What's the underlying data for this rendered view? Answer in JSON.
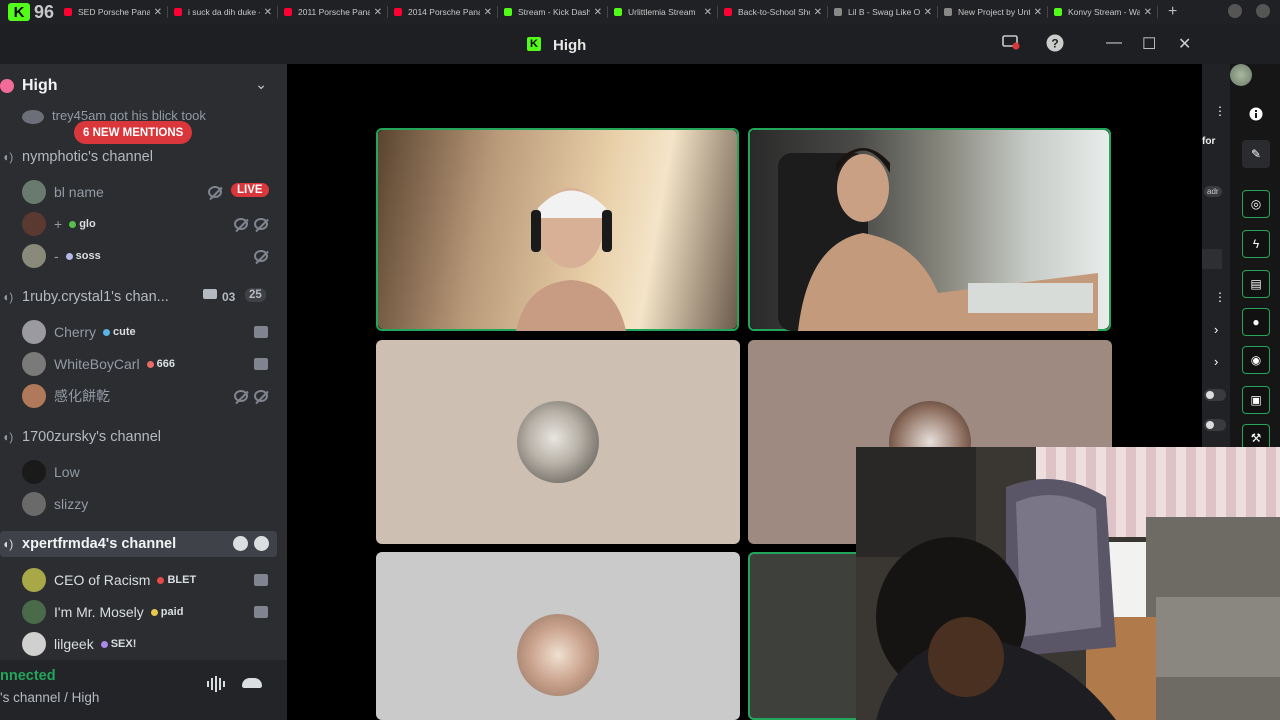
{
  "browser": {
    "tab_count": "96",
    "tabs": [
      {
        "label": "SED Porsche Panam",
        "kind": "yt"
      },
      {
        "label": "i suck da dih duke -",
        "kind": "yt"
      },
      {
        "label": "2011 Porsche Panam",
        "kind": "yt"
      },
      {
        "label": "2014 Porsche Panam",
        "kind": "yt"
      },
      {
        "label": "Stream - Kick Dashb",
        "kind": "kick"
      },
      {
        "label": "Urlittlemia Stream",
        "kind": "kick"
      },
      {
        "label": "Back-to-School Sho",
        "kind": "yt"
      },
      {
        "label": "Lil B - Swag Like Oh",
        "kind": "gen"
      },
      {
        "label": "New Project by Unt",
        "kind": "gen"
      },
      {
        "label": "Konvy Stream - Wa",
        "kind": "kick"
      }
    ]
  },
  "window": {
    "title": "High"
  },
  "sidebar": {
    "server_name": "High",
    "partial_user": "trey45am got his blick took",
    "mentions_badge": "6 NEW MENTIONS",
    "channels": [
      {
        "name": "nymphotic's channel",
        "members": [
          {
            "name": "bl name",
            "tag": "",
            "badge": "LIVE"
          },
          {
            "name": "+",
            "tag": "glo"
          },
          {
            "name": "-",
            "tag": "soss"
          }
        ]
      },
      {
        "name": "1ruby.crystal1's chan...",
        "count_video": "03",
        "count_users": "25",
        "members": [
          {
            "name": "Cherry",
            "tag": "cute"
          },
          {
            "name": "WhiteBoyCarl",
            "tag": "666"
          },
          {
            "name": "感化餅乾",
            "tag": ""
          }
        ]
      },
      {
        "name": "1700zursky's channel",
        "members": [
          {
            "name": "Low",
            "tag": ""
          },
          {
            "name": "slizzy",
            "tag": ""
          }
        ]
      },
      {
        "name": "xpertfrmda4's channel",
        "members": [
          {
            "name": "CEO of Racism",
            "tag": "BLET"
          },
          {
            "name": "I'm Mr. Mosely",
            "tag": "paid"
          },
          {
            "name": "lilgeek",
            "tag": "SEX!"
          }
        ]
      }
    ],
    "voice_status": "nnected",
    "voice_location": "'s channel / High"
  },
  "right_panel": {
    "text_for": "for",
    "text_adr": "adr"
  },
  "colors": {
    "accent_green": "#23a55a",
    "kick_green": "#53fc18",
    "live_red": "#da373c"
  }
}
